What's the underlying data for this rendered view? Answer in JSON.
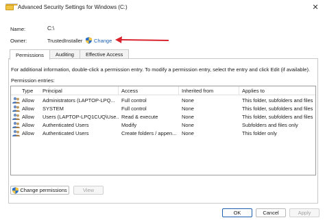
{
  "window": {
    "title": "Advanced Security Settings for Windows (C:)"
  },
  "fields": {
    "name_label": "Name:",
    "name_value": "C:\\",
    "owner_label": "Owner:",
    "owner_value": "TrustedInstaller",
    "change_label": "Change"
  },
  "tabs": [
    {
      "label": "Permissions"
    },
    {
      "label": "Auditing"
    },
    {
      "label": "Effective Access"
    }
  ],
  "info_text": "For additional information, double-click a permission entry. To modify a permission entry, select the entry and click Edit (if available).",
  "entries_label": "Permission entries:",
  "table": {
    "headers": [
      "Type",
      "Principal",
      "Access",
      "Inherited from",
      "Applies to"
    ],
    "rows": [
      {
        "type": "Allow",
        "principal": "Administrators (LAPTOP-LPQ...",
        "access": "Full control",
        "inherited": "None",
        "applies": "This folder, subfolders and files"
      },
      {
        "type": "Allow",
        "principal": "SYSTEM",
        "access": "Full control",
        "inherited": "None",
        "applies": "This folder, subfolders and files"
      },
      {
        "type": "Allow",
        "principal": "Users (LAPTOP-LPQ1CUQ\\Use...",
        "access": "Read & execute",
        "inherited": "None",
        "applies": "This folder, subfolders and files"
      },
      {
        "type": "Allow",
        "principal": "Authenticated Users",
        "access": "Modify",
        "inherited": "None",
        "applies": "Subfolders and files only"
      },
      {
        "type": "Allow",
        "principal": "Authenticated Users",
        "access": "Create folders / appen...",
        "inherited": "None",
        "applies": "This folder only"
      }
    ]
  },
  "buttons": {
    "change_permissions": "Change permissions",
    "view": "View",
    "ok": "OK",
    "cancel": "Cancel",
    "apply": "Apply"
  },
  "colors": {
    "link": "#1c5fb0",
    "annotation_arrow": "#d9232d"
  }
}
